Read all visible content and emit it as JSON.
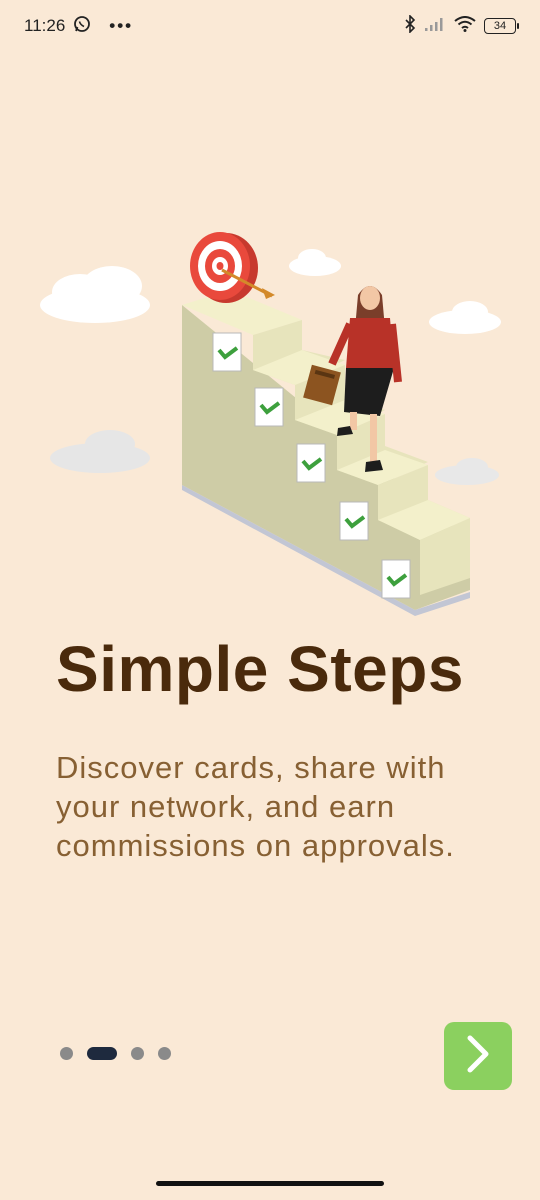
{
  "status_bar": {
    "time": "11:26",
    "more": "•••",
    "battery": "34"
  },
  "onboarding": {
    "title": "Simple Steps",
    "description": "Discover cards, share with your network, and earn commissions on approvals."
  },
  "pager": {
    "pages": 4,
    "active_index": 1
  },
  "colors": {
    "background": "#FAE9D6",
    "title": "#4A2A0C",
    "description": "#876033",
    "next_button": "#8BD05F",
    "active_dot": "#1E2A3E",
    "inactive_dot": "#8A8A8A"
  },
  "icons": {
    "next": "chevron-right-icon",
    "whatsapp": "whatsapp-icon",
    "bluetooth": "bluetooth-icon",
    "signal": "signal-icon",
    "wifi": "wifi-icon"
  }
}
